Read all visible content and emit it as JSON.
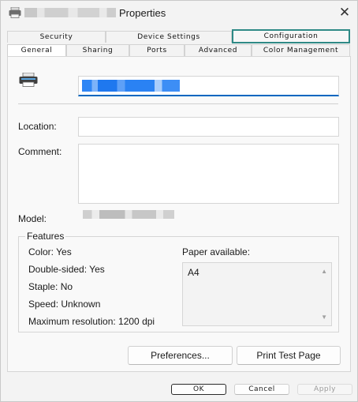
{
  "window": {
    "title": "Properties",
    "close_glyph": "✕"
  },
  "tabs": {
    "top": [
      "Security",
      "Device Settings",
      "Configuration"
    ],
    "bottom": [
      "General",
      "Sharing",
      "Ports",
      "Advanced",
      "Color Management"
    ],
    "active": "General",
    "focused": "Configuration"
  },
  "general": {
    "location_label": "Location:",
    "location_value": "",
    "comment_label": "Comment:",
    "comment_value": "",
    "model_label": "Model:"
  },
  "features": {
    "legend": "Features",
    "color": "Color: Yes",
    "double_sided": "Double-sided: Yes",
    "staple": "Staple: No",
    "speed": "Speed: Unknown",
    "max_resolution": "Maximum resolution: 1200 dpi",
    "paper_label": "Paper available:",
    "paper_items": [
      "A4"
    ]
  },
  "buttons": {
    "preferences": "Preferences...",
    "print_test_page": "Print Test Page",
    "ok": "OK",
    "cancel": "Cancel",
    "apply": "Apply"
  },
  "icons": {
    "title": "printer-icon",
    "device": "printer-icon",
    "close": "close-icon",
    "scroll_up": "scroll-up-arrow-icon",
    "scroll_down": "scroll-down-arrow-icon"
  },
  "colors": {
    "accent": "#0067c0",
    "focus_outline": "#2f8a86"
  }
}
